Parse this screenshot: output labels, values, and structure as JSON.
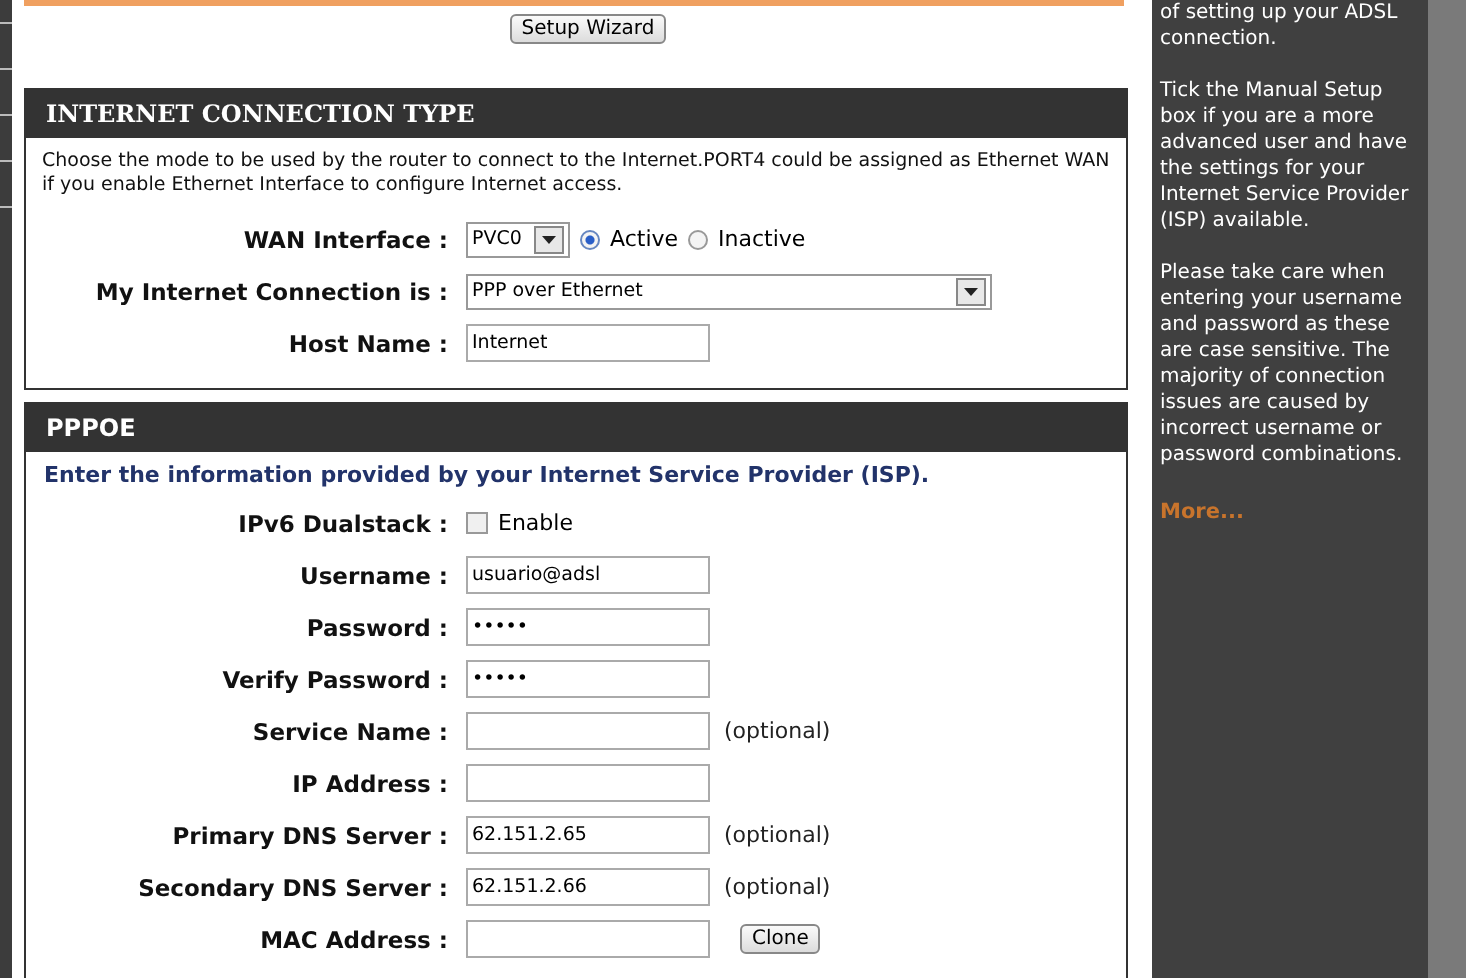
{
  "setup_wizard_button": "Setup Wizard",
  "internet_connection_type": {
    "title": "INTERNET CONNECTION TYPE",
    "description": "Choose the mode to be used by the router to connect to the Internet.PORT4 could be assigned as Ethernet WAN if you enable Ethernet Interface to configure Internet access.",
    "wan_interface": {
      "label": "WAN Interface :",
      "value": "PVC0",
      "options": [
        {
          "label": "Active",
          "selected": true
        },
        {
          "label": "Inactive",
          "selected": false
        }
      ]
    },
    "connection": {
      "label": "My Internet Connection is :",
      "value": "PPP over Ethernet"
    },
    "host_name": {
      "label": "Host Name :",
      "value": "Internet"
    }
  },
  "pppoe": {
    "title": "PPPOE",
    "intro": "Enter the information provided by your Internet Service Provider (ISP).",
    "fields": [
      {
        "kind": "checkbox",
        "label": "IPv6 Dualstack :",
        "option": "Enable",
        "checked": false
      },
      {
        "kind": "text",
        "label": "Username :",
        "value": "usuario@adsl"
      },
      {
        "kind": "text",
        "label": "Password :",
        "value": "•••••"
      },
      {
        "kind": "text",
        "label": "Verify Password :",
        "value": "•••••"
      },
      {
        "kind": "text",
        "label": "Service Name :",
        "note": "(optional)"
      },
      {
        "kind": "text",
        "label": "IP Address :"
      },
      {
        "kind": "text",
        "label": "Primary DNS Server :",
        "value": "62.151.2.65",
        "note": "(optional)"
      },
      {
        "kind": "text",
        "label": "Secondary DNS Server :",
        "value": "62.151.2.66",
        "note": "(optional)"
      },
      {
        "kind": "text",
        "label": "MAC Address :",
        "button": "Clone"
      }
    ]
  },
  "help": {
    "paragraphs": [
      "of setting up your ADSL connection.",
      "Tick the Manual Setup box if you are a more advanced user and have the settings for your Internet Service Provider (ISP) available.",
      "Please take care when entering your username and password as these are case sensitive. The majority of connection issues are caused by incorrect username or password combinations."
    ],
    "more": "More..."
  }
}
